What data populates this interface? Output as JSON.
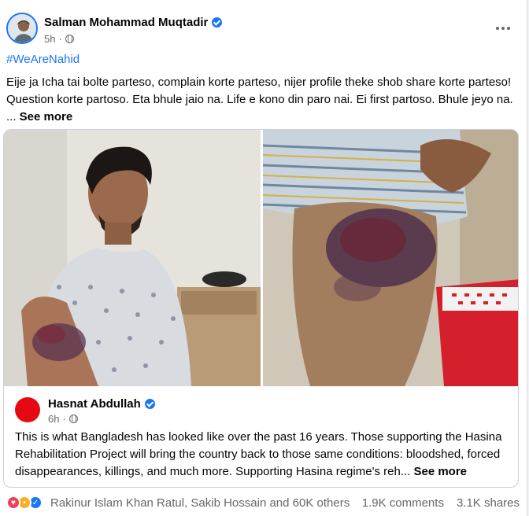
{
  "post": {
    "author": "Salman Mohammad Muqtadir",
    "time": "5h",
    "separator": "·",
    "hashtag": "#WeAreNahid",
    "lines": [
      "Eije ja Icha tai bolte parteso, complain korte parteso,  nijer profile theke shob share korte parteso!",
      "Question korte partoso. Eta bhule jaio na.  Life e kono din paro nai. Ei first partoso. Bhule jeyo na."
    ],
    "ellipsis": "... ",
    "see_more": "See more"
  },
  "shared_post": {
    "author": "Hasnat Abdullah",
    "time": "6h",
    "separator": "·",
    "lines": [
      "This is what Bangladesh has looked like over the past 16 years. Those supporting the Hasina",
      "Rehabilitation Project will bring the country back to those same conditions: bloodshed, forced",
      "disappearances, killings, and much more. Supporting Hasina regime's reh..."
    ],
    "see_more": "See more"
  },
  "footer": {
    "reaction_names": "Rakinur Islam Khan Ratul, Sakib Hossain and 60K others",
    "comments": "1.9K comments",
    "shares": "3.1K shares"
  },
  "icons": {
    "verified": "verified-badge-icon",
    "audience": "globe-icon",
    "more": "more-options-icon",
    "reactions": [
      "love-reaction-icon",
      "sad-reaction-icon",
      "like-reaction-icon"
    ]
  },
  "colors": {
    "link": "#1877f2",
    "secondary_text": "#65676b",
    "shared_avatar": "#e50914"
  }
}
